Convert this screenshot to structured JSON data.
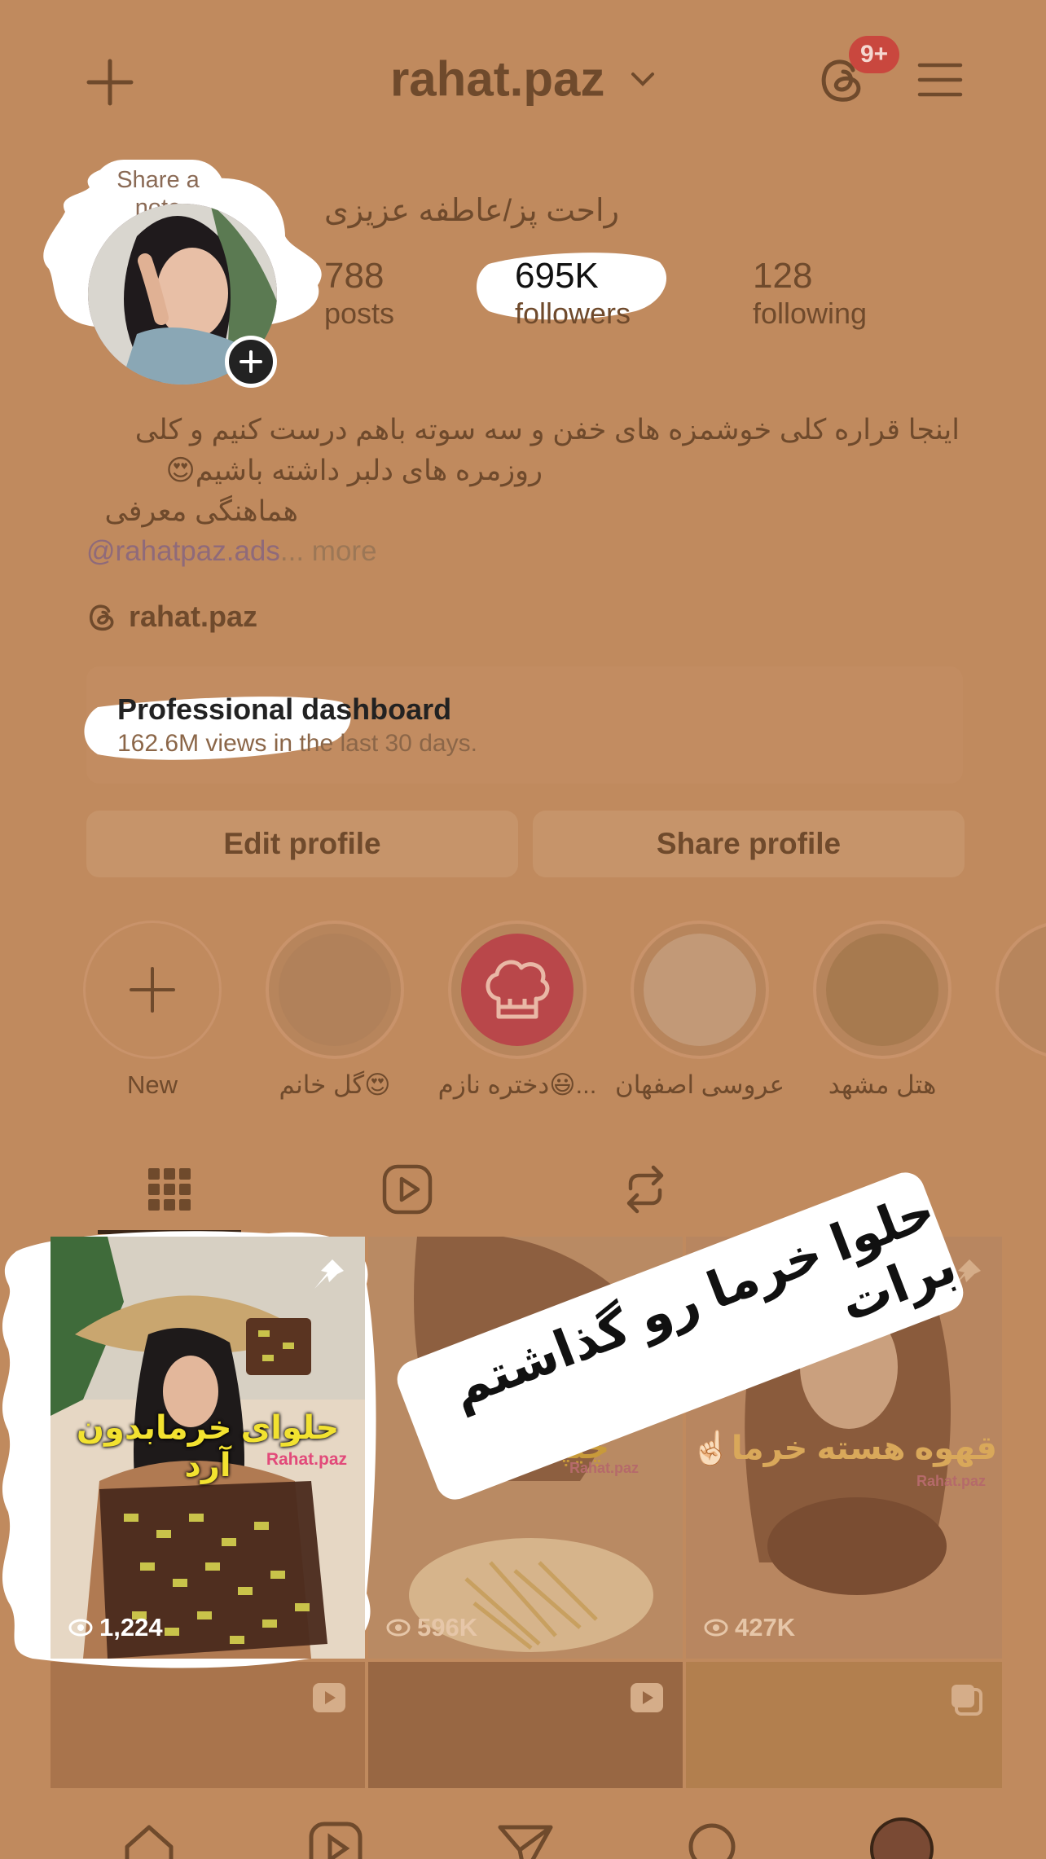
{
  "header": {
    "username": "rahat.paz",
    "notif_badge": "9+"
  },
  "profile": {
    "note_bubble": "Share a note",
    "display_name": "راحت پز/عاطفه عزیزی",
    "stats": [
      {
        "value": "788",
        "label": "posts"
      },
      {
        "value": "695K",
        "label": "followers"
      },
      {
        "value": "128",
        "label": "following"
      }
    ],
    "bio_line1": "اینجا قراره کلی خوشمزه های خفن و سه سوته باهم درست کنیم و کلی",
    "bio_line2": "روزمره های دلبر داشته باشیم😍",
    "bio_line3": "هماهنگی معرفی",
    "bio_link": "@rahatpaz.ads",
    "bio_more": "... more",
    "threads_handle": "rahat.paz"
  },
  "dashboard": {
    "title": "Professional dashboard",
    "subtitle": "162.6M views in the last 30 days."
  },
  "actions": {
    "edit_profile": "Edit profile",
    "share_profile": "Share profile"
  },
  "highlights": [
    {
      "label": "New"
    },
    {
      "label": "گل خانم😍"
    },
    {
      "label": "دختره نازم😃..."
    },
    {
      "label": "عروسی اصفهان"
    },
    {
      "label": "هتل مشهد"
    }
  ],
  "tabs": [
    "posts-grid",
    "reels",
    "reposts"
  ],
  "grid": [
    {
      "title": "حلوای خرمابدون آرد",
      "watermark": "Rahat.paz",
      "views": "1,224",
      "pinned": true
    },
    {
      "title": "چیپس مرغ",
      "watermark": "Rahat.paz",
      "views": "596K",
      "pinned": false
    },
    {
      "title": "قهوه هسته خرما☝🏻",
      "watermark": "Rahat.paz",
      "views": "427K",
      "pinned": true
    }
  ],
  "sticker_text": "حلوا خرما رو گذاشتم برات",
  "colors": {
    "overlay": "#c08a5e",
    "text": "#6f4a2c",
    "badge": "#c9473e",
    "sticker_bg": "#ffffff"
  }
}
